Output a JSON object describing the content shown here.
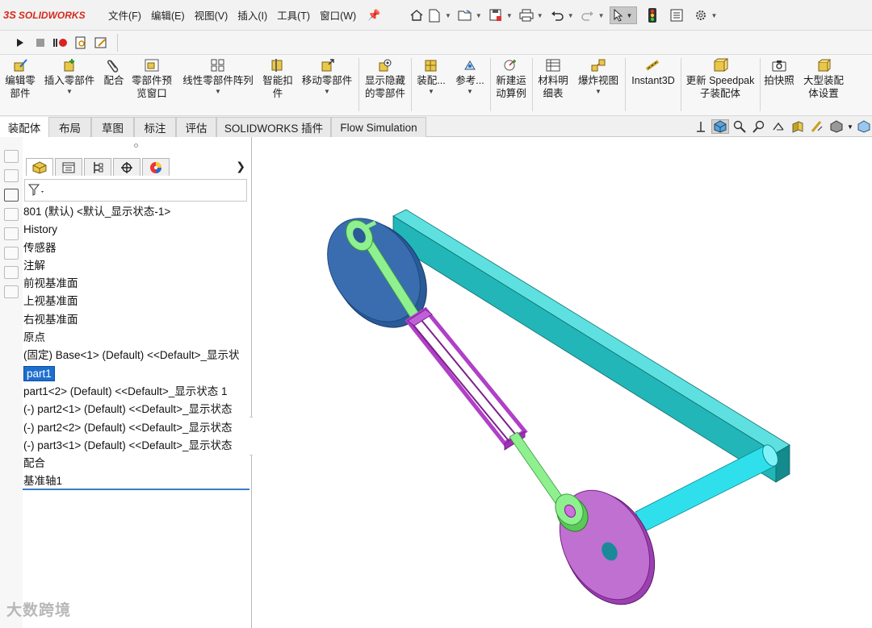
{
  "app": {
    "logo_mark": "3S",
    "logo_word": "SOLIDWORKS"
  },
  "menu": [
    "文件(F)",
    "编辑(E)",
    "视图(V)",
    "插入(I)",
    "工具(T)",
    "窗口(W)"
  ],
  "quick_access_icons": [
    "home-icon",
    "new-doc-icon",
    "open-icon",
    "save-icon",
    "print-icon",
    "undo-icon",
    "redo-icon",
    "select-arrow-icon",
    "traffic-light-icon",
    "file-props-icon",
    "gear-icon"
  ],
  "macro_icons": [
    "play-icon",
    "stop-icon",
    "record-icon",
    "new-macro-icon",
    "edit-macro-icon"
  ],
  "commands": [
    {
      "label": "编辑零\n部件"
    },
    {
      "label": "插入零部件"
    },
    {
      "label": "配合"
    },
    {
      "label": "零部件预\n览窗口"
    },
    {
      "label": "线性零部件阵列"
    },
    {
      "label": "智能扣\n件"
    },
    {
      "label": "移动零部件"
    },
    {
      "label": "显示隐藏\n的零部件"
    },
    {
      "label": "装配..."
    },
    {
      "label": "参考..."
    },
    {
      "label": "新建运\n动算例"
    },
    {
      "label": "材料明\n细表"
    },
    {
      "label": "爆炸视图"
    },
    {
      "label": "Instant3D"
    },
    {
      "label": "更新 Speedpak\n子装配体"
    },
    {
      "label": "拍快照"
    },
    {
      "label": "大型装配\n体设置"
    }
  ],
  "tabs": [
    "装配体",
    "布局",
    "草图",
    "标注",
    "评估",
    "SOLIDWORKS 插件",
    "Flow Simulation"
  ],
  "feature_tree": {
    "nodes": [
      "801 (默认) <默认_显示状态-1>",
      "History",
      "传感器",
      "注解",
      "前视基准面",
      "上视基准面",
      "右视基准面",
      "原点",
      "(固定) Base<1> (Default) <<Default>_显示状",
      "part1",
      "part1<2> (Default) <<Default>_显示状态 1",
      "(-) part2<1> (Default) <<Default>_显示状态",
      "(-) part2<2> (Default) <<Default>_显示状态",
      "(-) part3<1> (Default) <<Default>_显示状态",
      "配合",
      "基准轴1"
    ],
    "selected_index": 9
  },
  "watermark": "大数跨境",
  "colors": {
    "accent": "#1d6fce",
    "logo_red": "#d52b1e",
    "link_green": "#8ef08e",
    "slider_purple": "#b040c8",
    "base_teal": "#22b6b8",
    "disc_blue": "#3a6db0",
    "disc_purple": "#c070d0",
    "shaft_cyan": "#2fe0ec"
  }
}
